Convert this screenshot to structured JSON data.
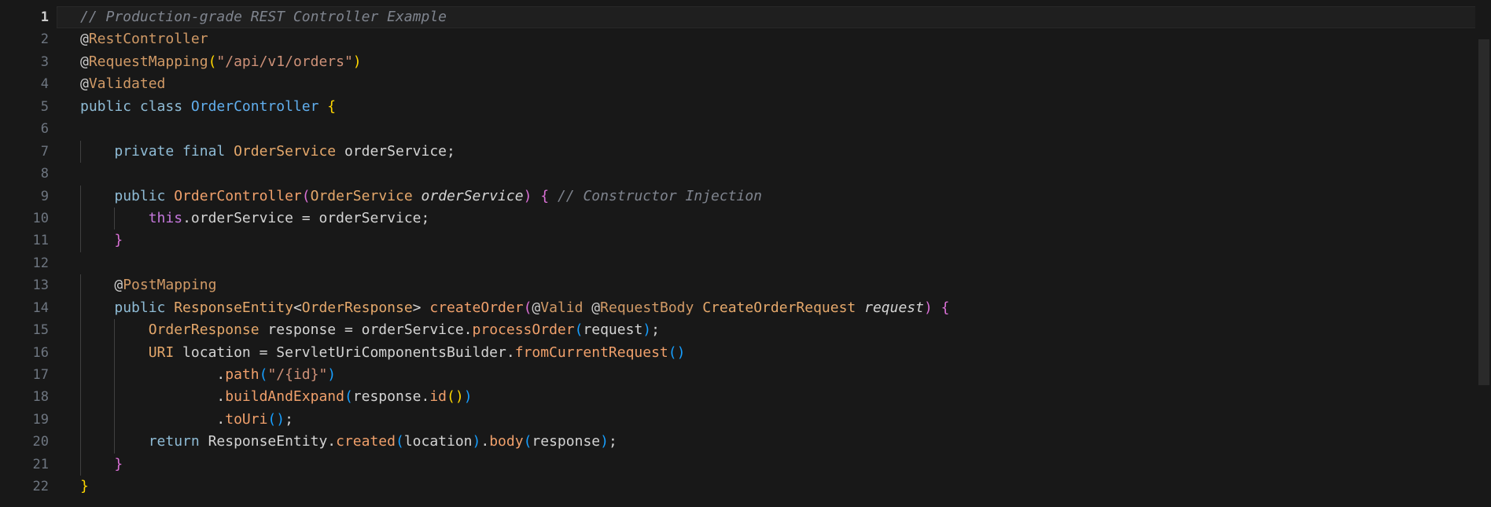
{
  "editor": {
    "active_line": 1,
    "colors": {
      "background": "#181818",
      "comment": "#7f848e",
      "annotation": "#d19a66",
      "keyword": "#8fbcd6",
      "type": "#e5a86b",
      "class": "#61afef",
      "string": "#ce9178",
      "brace_gold": "#ffd700",
      "brace_purple": "#da70d6",
      "brace_blue": "#179fff"
    },
    "lines": [
      {
        "number": "1",
        "indent": 0,
        "tokens": [
          {
            "t": "comment",
            "v": "// Production-grade REST Controller Example"
          }
        ]
      },
      {
        "number": "2",
        "indent": 0,
        "tokens": [
          {
            "t": "at",
            "v": "@"
          },
          {
            "t": "annotation",
            "v": "RestController"
          }
        ]
      },
      {
        "number": "3",
        "indent": 0,
        "tokens": [
          {
            "t": "at",
            "v": "@"
          },
          {
            "t": "annotation",
            "v": "RequestMapping"
          },
          {
            "t": "brace1",
            "v": "("
          },
          {
            "t": "string",
            "v": "\"/api/v1/orders\""
          },
          {
            "t": "brace1",
            "v": ")"
          }
        ]
      },
      {
        "number": "4",
        "indent": 0,
        "tokens": [
          {
            "t": "at",
            "v": "@"
          },
          {
            "t": "annotation",
            "v": "Validated"
          }
        ]
      },
      {
        "number": "5",
        "indent": 0,
        "tokens": [
          {
            "t": "keyword",
            "v": "public class "
          },
          {
            "t": "class",
            "v": "OrderController"
          },
          {
            "t": "plain",
            "v": " "
          },
          {
            "t": "brace1",
            "v": "{"
          }
        ]
      },
      {
        "number": "6",
        "indent": 0,
        "tokens": []
      },
      {
        "number": "7",
        "indent": 1,
        "tokens": [
          {
            "t": "keyword",
            "v": "private final "
          },
          {
            "t": "type",
            "v": "OrderService"
          },
          {
            "t": "plain",
            "v": " orderService;"
          }
        ]
      },
      {
        "number": "8",
        "indent": 0,
        "tokens": []
      },
      {
        "number": "9",
        "indent": 1,
        "tokens": [
          {
            "t": "keyword",
            "v": "public "
          },
          {
            "t": "method",
            "v": "OrderController"
          },
          {
            "t": "brace2",
            "v": "("
          },
          {
            "t": "type",
            "v": "OrderService"
          },
          {
            "t": "plain",
            "v": " "
          },
          {
            "t": "param",
            "v": "orderService"
          },
          {
            "t": "brace2",
            "v": ")"
          },
          {
            "t": "plain",
            "v": " "
          },
          {
            "t": "brace2",
            "v": "{"
          },
          {
            "t": "plain",
            "v": " "
          },
          {
            "t": "comment",
            "v": "// Constructor Injection"
          }
        ]
      },
      {
        "number": "10",
        "indent": 2,
        "tokens": [
          {
            "t": "this",
            "v": "this"
          },
          {
            "t": "plain",
            "v": ".orderService = orderService;"
          }
        ]
      },
      {
        "number": "11",
        "indent": 1,
        "tokens": [
          {
            "t": "brace2",
            "v": "}"
          }
        ]
      },
      {
        "number": "12",
        "indent": 0,
        "tokens": []
      },
      {
        "number": "13",
        "indent": 1,
        "tokens": [
          {
            "t": "at",
            "v": "@"
          },
          {
            "t": "annotation",
            "v": "PostMapping"
          }
        ]
      },
      {
        "number": "14",
        "indent": 1,
        "tokens": [
          {
            "t": "keyword",
            "v": "public "
          },
          {
            "t": "type",
            "v": "ResponseEntity"
          },
          {
            "t": "plain",
            "v": "<"
          },
          {
            "t": "type",
            "v": "OrderResponse"
          },
          {
            "t": "plain",
            "v": "> "
          },
          {
            "t": "method",
            "v": "createOrder"
          },
          {
            "t": "brace2",
            "v": "("
          },
          {
            "t": "at",
            "v": "@"
          },
          {
            "t": "annotation",
            "v": "Valid"
          },
          {
            "t": "plain",
            "v": " "
          },
          {
            "t": "at",
            "v": "@"
          },
          {
            "t": "annotation",
            "v": "RequestBody"
          },
          {
            "t": "plain",
            "v": " "
          },
          {
            "t": "type",
            "v": "CreateOrderRequest"
          },
          {
            "t": "plain",
            "v": " "
          },
          {
            "t": "param",
            "v": "request"
          },
          {
            "t": "brace2",
            "v": ")"
          },
          {
            "t": "plain",
            "v": " "
          },
          {
            "t": "brace2",
            "v": "{"
          }
        ]
      },
      {
        "number": "15",
        "indent": 2,
        "tokens": [
          {
            "t": "type",
            "v": "OrderResponse"
          },
          {
            "t": "plain",
            "v": " response = orderService."
          },
          {
            "t": "method",
            "v": "processOrder"
          },
          {
            "t": "brace3",
            "v": "("
          },
          {
            "t": "plain",
            "v": "request"
          },
          {
            "t": "brace3",
            "v": ")"
          },
          {
            "t": "plain",
            "v": ";"
          }
        ]
      },
      {
        "number": "16",
        "indent": 2,
        "tokens": [
          {
            "t": "type",
            "v": "URI"
          },
          {
            "t": "plain",
            "v": " location = ServletUriComponentsBuilder."
          },
          {
            "t": "method",
            "v": "fromCurrentRequest"
          },
          {
            "t": "brace3",
            "v": "()"
          }
        ]
      },
      {
        "number": "17",
        "indent": 4,
        "tokens": [
          {
            "t": "plain",
            "v": "."
          },
          {
            "t": "method",
            "v": "path"
          },
          {
            "t": "brace3",
            "v": "("
          },
          {
            "t": "string",
            "v": "\"/{id}\""
          },
          {
            "t": "brace3",
            "v": ")"
          }
        ]
      },
      {
        "number": "18",
        "indent": 4,
        "tokens": [
          {
            "t": "plain",
            "v": "."
          },
          {
            "t": "method",
            "v": "buildAndExpand"
          },
          {
            "t": "brace3",
            "v": "("
          },
          {
            "t": "plain",
            "v": "response."
          },
          {
            "t": "method",
            "v": "id"
          },
          {
            "t": "brace1",
            "v": "()"
          },
          {
            "t": "brace3",
            "v": ")"
          }
        ]
      },
      {
        "number": "19",
        "indent": 4,
        "tokens": [
          {
            "t": "plain",
            "v": "."
          },
          {
            "t": "method",
            "v": "toUri"
          },
          {
            "t": "brace3",
            "v": "()"
          },
          {
            "t": "plain",
            "v": ";"
          }
        ]
      },
      {
        "number": "20",
        "indent": 2,
        "tokens": [
          {
            "t": "keyword",
            "v": "return "
          },
          {
            "t": "plain",
            "v": "ResponseEntity."
          },
          {
            "t": "method",
            "v": "created"
          },
          {
            "t": "brace3",
            "v": "("
          },
          {
            "t": "plain",
            "v": "location"
          },
          {
            "t": "brace3",
            "v": ")"
          },
          {
            "t": "plain",
            "v": "."
          },
          {
            "t": "method",
            "v": "body"
          },
          {
            "t": "brace3",
            "v": "("
          },
          {
            "t": "plain",
            "v": "response"
          },
          {
            "t": "brace3",
            "v": ")"
          },
          {
            "t": "plain",
            "v": ";"
          }
        ]
      },
      {
        "number": "21",
        "indent": 1,
        "tokens": [
          {
            "t": "brace2",
            "v": "}"
          }
        ]
      },
      {
        "number": "22",
        "indent": 0,
        "tokens": [
          {
            "t": "brace1",
            "v": "}"
          }
        ]
      }
    ]
  }
}
